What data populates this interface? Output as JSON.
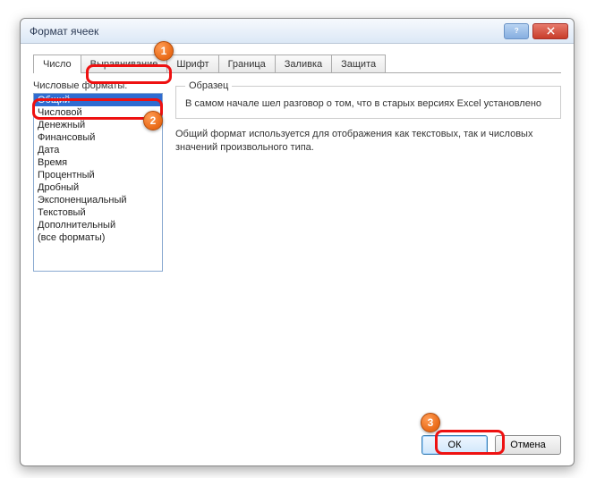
{
  "window": {
    "title": "Формат ячеек"
  },
  "tabs": {
    "number": "Число",
    "alignment": "Выравнивание",
    "font": "Шрифт",
    "border": "Граница",
    "fill": "Заливка",
    "protection": "Защита"
  },
  "formats_label": "Числовые форматы:",
  "formats": [
    "Общий",
    "Числовой",
    "Денежный",
    "Финансовый",
    "Дата",
    "Время",
    "Процентный",
    "Дробный",
    "Экспоненциальный",
    "Текстовый",
    "Дополнительный",
    "(все форматы)"
  ],
  "sample": {
    "legend": "Образец",
    "text": "В самом начале шел разговор о том, что в старых версиях Excel установлено"
  },
  "description": "Общий формат используется для отображения как текстовых, так и числовых значений произвольного типа.",
  "buttons": {
    "ok": "ОК",
    "cancel": "Отмена"
  },
  "annotations": {
    "b1": "1",
    "b2": "2",
    "b3": "3"
  }
}
